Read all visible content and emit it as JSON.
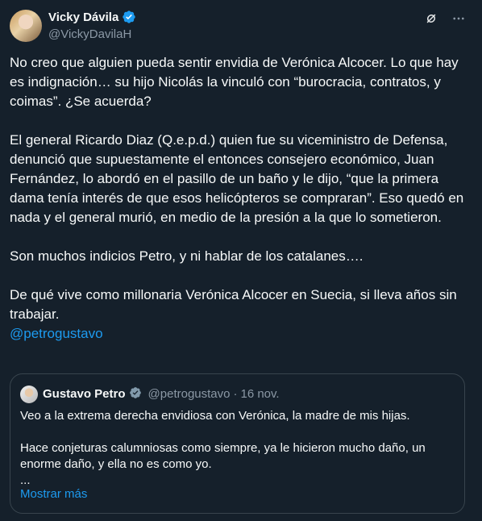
{
  "author": {
    "display_name": "Vicky Dávila",
    "handle": "@VickyDavilaH"
  },
  "icons": {
    "verified": "verified-badge-icon",
    "grok": "grok-icon",
    "more": "more-options-icon"
  },
  "colors": {
    "background": "#15202b",
    "text": "#f7f9f9",
    "secondary": "#8b98a5",
    "accent": "#1d9bf0",
    "border": "#38444d"
  },
  "tweet": {
    "paragraphs": [
      "No creo que alguien pueda sentir envidia de Verónica Alcocer. Lo que hay es indignación… su hijo Nicolás la vinculó con “burocracia, contratos, y coimas”. ¿Se acuerda?",
      "El general Ricardo Diaz (Q.e.p.d.) quien fue su viceministro de Defensa, denunció que supuestamente el entonces consejero económico, Juan Fernández, lo abordó en el pasillo de un baño y le dijo, “que la primera dama tenía interés de que esos helicópteros se compraran”. Eso quedó en nada y el general murió, en medio de la presión a la que lo sometieron.",
      "Son muchos indicios Petro, y ni hablar de los catalanes….",
      "De qué vive como millonaria Verónica Alcocer en Suecia, si lleva años sin trabajar."
    ],
    "mention": "@petrogustavo"
  },
  "quoted": {
    "display_name": "Gustavo Petro",
    "handle": "@petrogustavo",
    "separator": "·",
    "date": "16 nov.",
    "line1": "Veo a la extrema derecha envidiosa con Verónica, la madre de mis hijas.",
    "line2": "Hace conjeturas calumniosas como siempre,   ya le hicieron mucho daño, un enorme daño, y ella no es como yo.",
    "ellipsis": "...",
    "show_more": "Mostrar más"
  }
}
